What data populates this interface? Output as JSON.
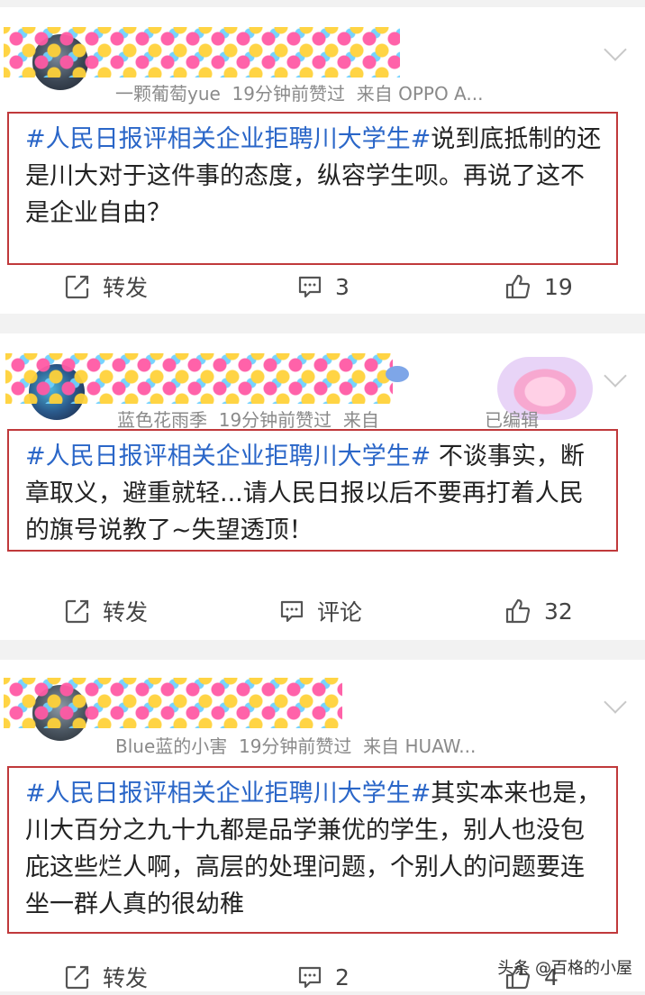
{
  "posts": [
    {
      "username": "一颗葡萄yue",
      "time": "19分钟前赞过",
      "source": "来自 OPPO A...",
      "hashtag": "#人民日报评相关企业拒聘川大学生#",
      "body": "说到底抵制的还是川大对于这件事的态度，纵容学生呗。再说了这不是企业自由？",
      "repost_label": "转发",
      "comment_label": "3",
      "like_count": "19"
    },
    {
      "username": "蓝色花雨季",
      "time": "19分钟前赞过",
      "source": "来自",
      "edited": "已编辑",
      "hashtag": "#人民日报评相关企业拒聘川大学生#",
      "body": " 不谈事实，断章取义，避重就轻...请人民日报以后不要再打着人民的旗号说教了~失望透顶！",
      "repost_label": "转发",
      "comment_label": "评论",
      "like_count": "32"
    },
    {
      "username": "Blue蓝的小害",
      "time": "19分钟前赞过",
      "source": "来自 HUAW...",
      "hashtag": "#人民日报评相关企业拒聘川大学生#",
      "body": "其实本来也是，川大百分之九十九都是品学兼优的学生，别人也没包庇这些烂人啊，高层的处理问题，个别人的问题要连坐一群人真的很幼稚",
      "repost_label": "转发",
      "comment_label": "2",
      "like_count": "4"
    }
  ],
  "watermark": "头条 @百格的小屋",
  "icons": {
    "repost": "repost-icon",
    "comment": "comment-icon",
    "like": "thumbs-up-icon",
    "more": "chevron-down-icon"
  }
}
